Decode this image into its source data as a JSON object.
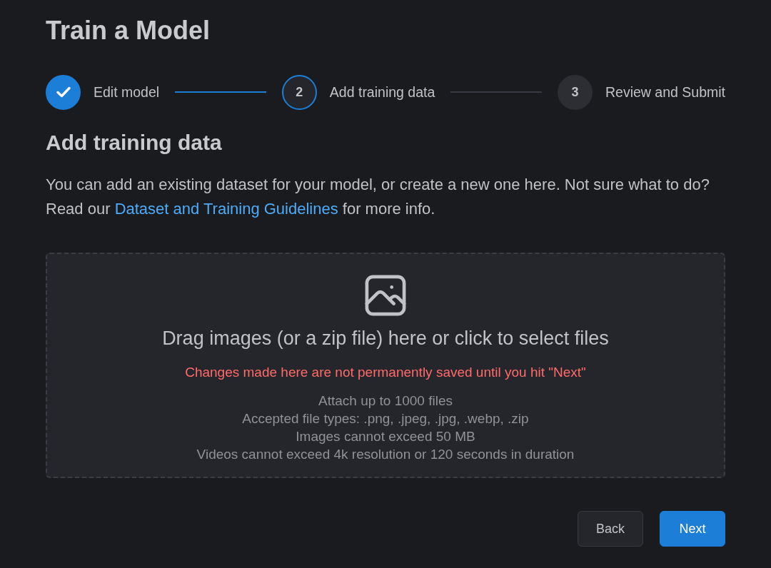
{
  "page": {
    "title": "Train a Model"
  },
  "stepper": {
    "steps": [
      {
        "label": "Edit model",
        "completed": true,
        "selected": false
      },
      {
        "number": "2",
        "label": "Add training data",
        "completed": false,
        "selected": true
      },
      {
        "number": "3",
        "label": "Review and Submit",
        "completed": false,
        "selected": false
      }
    ]
  },
  "section": {
    "heading": "Add training data",
    "intro": {
      "before": "You can add an existing dataset for your model, or create a new one here. Not sure what to do? Read our",
      "link": "Dataset and Training Guidelines",
      "after": "for more info."
    }
  },
  "dropzone": {
    "prompt": "Drag images (or a zip file) here or click to select files",
    "warning": "Changes made here are not permanently saved until you hit \"Next\"",
    "notes": [
      "Attach up to 1000 files",
      "Accepted file types: .png, .jpeg, .jpg, .webp, .zip",
      "Images cannot exceed 50 MB",
      "Videos cannot exceed 4k resolution or 120 seconds in duration"
    ]
  },
  "actions": [
    {
      "label": "Back",
      "kind": "default"
    },
    {
      "label": "Next",
      "kind": "primary"
    }
  ]
}
